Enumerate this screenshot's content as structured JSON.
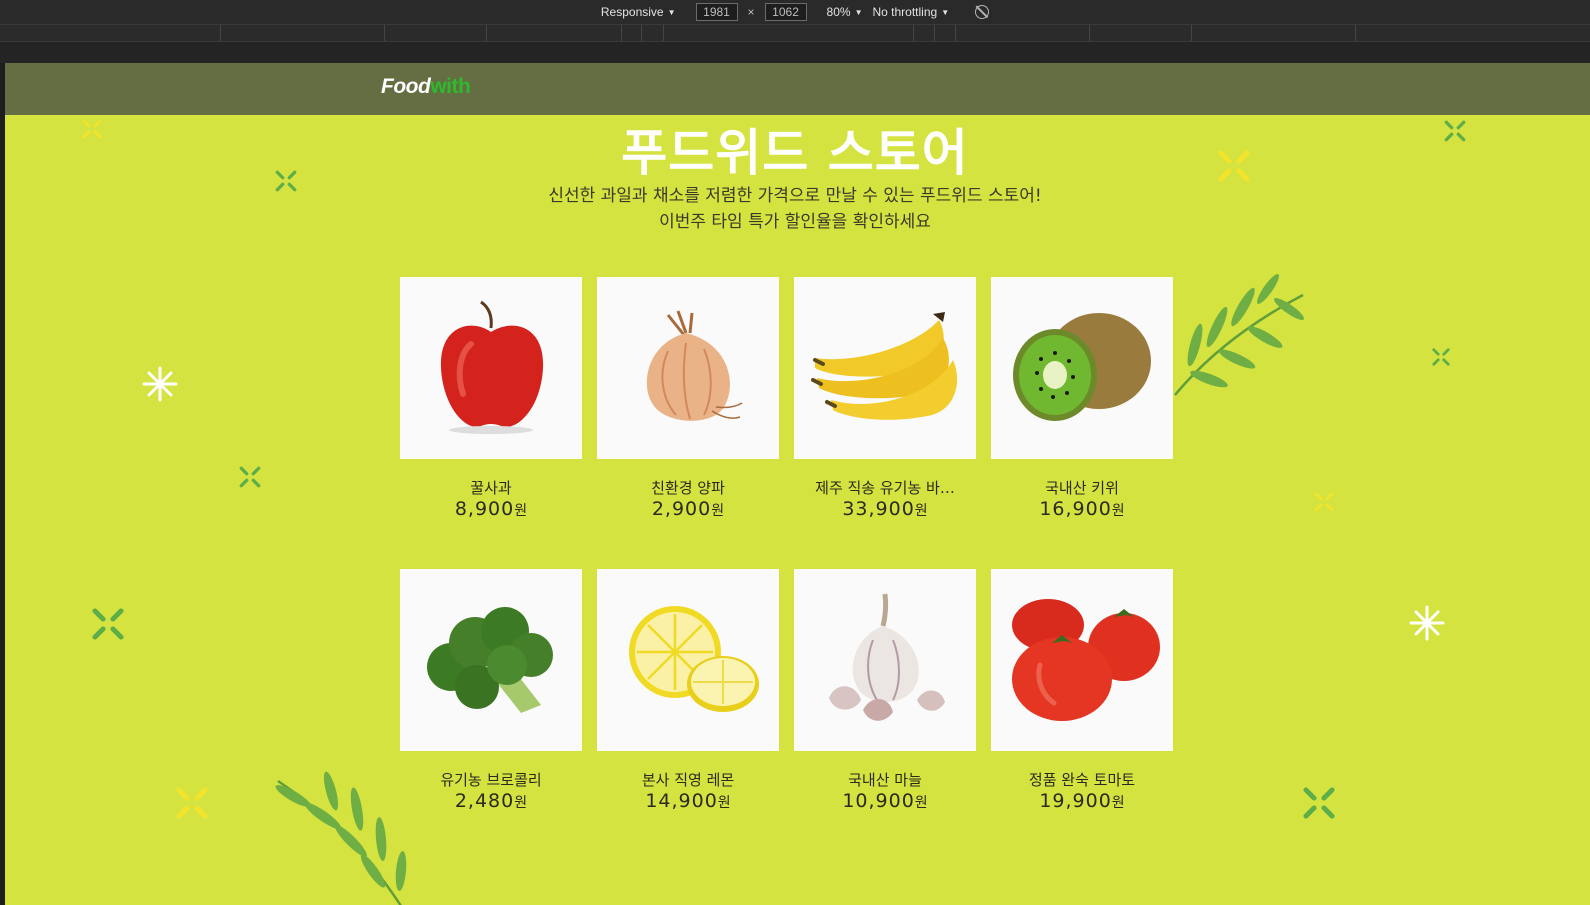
{
  "devtools": {
    "device": "Responsive",
    "width": "1981",
    "height": "1062",
    "times": "×",
    "zoom": "80%",
    "throttling": "No throttling"
  },
  "site": {
    "logo_food": "Food",
    "logo_with": "with",
    "title": "푸드위드 스토어",
    "subtitle_line1": "신선한 과일과 채소를 저렴한 가격으로 만날 수 있는 푸드위드 스토어!",
    "subtitle_line2": "이번주 타임 특가 할인율을 확인하세요",
    "currency": "원"
  },
  "products": [
    {
      "name": "꿀사과",
      "price": "8,900",
      "icon": "apple-icon"
    },
    {
      "name": "친환경 양파",
      "price": "2,900",
      "icon": "onion-icon"
    },
    {
      "name": "제주 직송 유기농 바…",
      "price": "33,900",
      "icon": "banana-icon"
    },
    {
      "name": "국내산 키위",
      "price": "16,900",
      "icon": "kiwi-icon"
    },
    {
      "name": "유기농 브로콜리",
      "price": "2,480",
      "icon": "broccoli-icon"
    },
    {
      "name": "본사 직영 레몬",
      "price": "14,900",
      "icon": "lemon-icon"
    },
    {
      "name": "국내산 마늘",
      "price": "10,900",
      "icon": "garlic-icon"
    },
    {
      "name": "정품 완숙 토마토",
      "price": "19,900",
      "icon": "tomato-icon"
    }
  ],
  "colors": {
    "background": "#d4e33f",
    "nav": "#656e42",
    "logo_accent": "#2dbb2d",
    "sparkle_green": "#5dae48",
    "sparkle_yellow": "#f3e42b"
  }
}
